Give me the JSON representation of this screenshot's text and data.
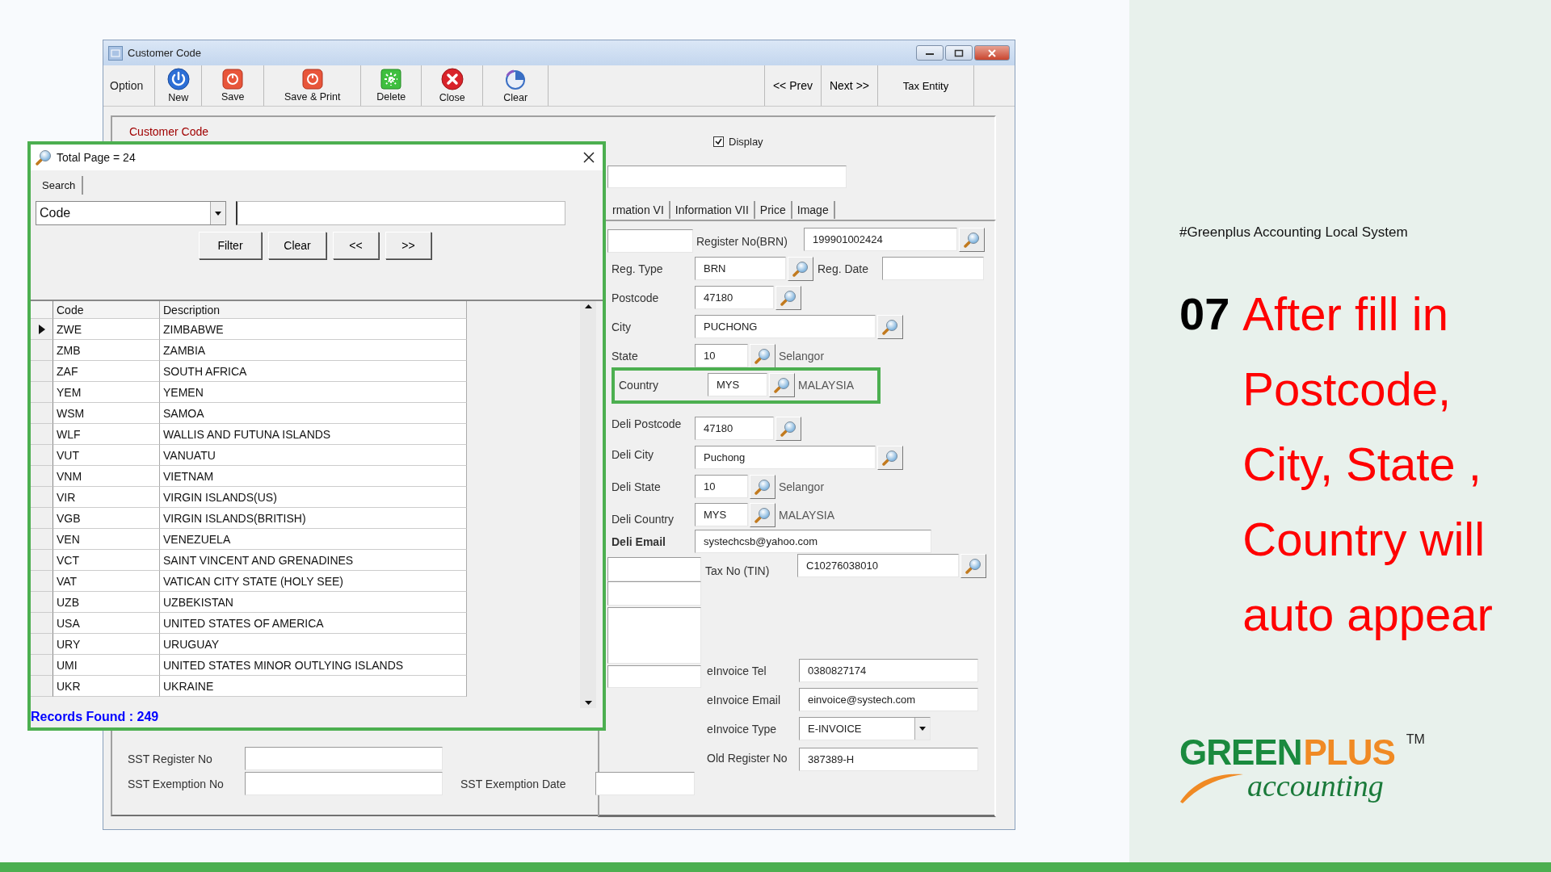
{
  "window": {
    "title": "Customer Code",
    "toolbar": {
      "option_label": "Option",
      "buttons": [
        {
          "label": "New",
          "kind": "new"
        },
        {
          "label": "Save",
          "kind": "save"
        },
        {
          "label": "Save & Print",
          "kind": "save"
        },
        {
          "label": "Delete",
          "kind": "delete"
        },
        {
          "label": "Close",
          "kind": "close"
        },
        {
          "label": "Clear",
          "kind": "clear"
        }
      ],
      "nav_buttons": [
        "<< Prev",
        "Next >>",
        "Tax Entity"
      ]
    },
    "form": {
      "customer_code_label": "Customer Code",
      "display": {
        "label": "Display",
        "checked": true
      },
      "tabs": [
        {
          "label": "rmation VI",
          "selected": false
        },
        {
          "label": "Information VII",
          "selected": false
        },
        {
          "label": "Price",
          "selected": false
        },
        {
          "label": "Image",
          "selected": false
        }
      ],
      "fields": [
        {
          "label": "Register No(BRN)",
          "value": "199901002424",
          "kind": "lookup",
          "highlighted": false
        },
        {
          "label": "Reg. Type",
          "value": "BRN",
          "kind": "lookup",
          "highlighted": false
        },
        {
          "label": "Reg. Date",
          "kind": "text",
          "highlighted": false
        },
        {
          "label": "Postcode",
          "value": "47180",
          "kind": "lookup",
          "highlighted": false
        },
        {
          "label": "City",
          "value": "PUCHONG",
          "kind": "lookup",
          "highlighted": false
        },
        {
          "label": "State",
          "value": "10",
          "kind": "lookup",
          "detail": "Selangor",
          "highlighted": false
        },
        {
          "label": "Country",
          "value": "MYS",
          "kind": "lookup",
          "detail": "MALAYSIA",
          "highlighted": true
        },
        {
          "label": "Deli Postcode",
          "value": "47180",
          "kind": "lookup",
          "highlighted": false
        },
        {
          "label": "Deli City",
          "value": "Puchong",
          "kind": "lookup",
          "highlighted": false
        },
        {
          "label": "Deli State",
          "value": "10",
          "kind": "lookup",
          "detail": "Selangor",
          "highlighted": false
        },
        {
          "label": "Deli Country",
          "value": "MYS",
          "kind": "lookup",
          "detail": "MALAYSIA",
          "highlighted": false
        },
        {
          "label": "Deli Email",
          "value": "systechcsb@yahoo.com",
          "kind": "text",
          "highlighted": false
        },
        {
          "label": "Tax No (TIN)",
          "value": "C10276038010",
          "kind": "lookup",
          "highlighted": false
        },
        {
          "label": "eInvoice Tel",
          "value": "0380827174",
          "kind": "text",
          "highlighted": false
        },
        {
          "label": "eInvoice Email",
          "value": "einvoice@systech.com",
          "kind": "text",
          "highlighted": false
        },
        {
          "label": "eInvoice Type",
          "value": "E-INVOICE",
          "kind": "combo",
          "highlighted": false
        },
        {
          "label": "SST Register No",
          "kind": "text",
          "highlighted": false
        },
        {
          "label": "Old Register No",
          "value": "387389-H",
          "kind": "text",
          "highlighted": false
        },
        {
          "label": "SST Exemption No",
          "kind": "text",
          "highlighted": false
        },
        {
          "label": "SST Exemption Date",
          "kind": "text",
          "highlighted": false
        }
      ]
    }
  },
  "lookup_dialog": {
    "title": "Total Page = 24",
    "tab": "Search",
    "search_by": "Code",
    "buttons": [
      "Filter",
      "Clear",
      "<<",
      ">>"
    ],
    "columns": [
      "Code",
      "Description"
    ],
    "rows": [
      {
        "code": "ZWE",
        "description": "ZIMBABWE",
        "selected": true
      },
      {
        "code": "ZMB",
        "description": "ZAMBIA",
        "selected": false
      },
      {
        "code": "ZAF",
        "description": "SOUTH AFRICA",
        "selected": false
      },
      {
        "code": "YEM",
        "description": "YEMEN",
        "selected": false
      },
      {
        "code": "WSM",
        "description": "SAMOA",
        "selected": false
      },
      {
        "code": "WLF",
        "description": "WALLIS AND FUTUNA ISLANDS",
        "selected": false
      },
      {
        "code": "VUT",
        "description": "VANUATU",
        "selected": false
      },
      {
        "code": "VNM",
        "description": "VIETNAM",
        "selected": false
      },
      {
        "code": "VIR",
        "description": "VIRGIN ISLANDS(US)",
        "selected": false
      },
      {
        "code": "VGB",
        "description": "VIRGIN ISLANDS(BRITISH)",
        "selected": false
      },
      {
        "code": "VEN",
        "description": "VENEZUELA",
        "selected": false
      },
      {
        "code": "VCT",
        "description": "SAINT VINCENT AND GRENADINES",
        "selected": false
      },
      {
        "code": "VAT",
        "description": "VATICAN CITY STATE (HOLY SEE)",
        "selected": false
      },
      {
        "code": "UZB",
        "description": "UZBEKISTAN",
        "selected": false
      },
      {
        "code": "USA",
        "description": "UNITED STATES OF AMERICA",
        "selected": false
      },
      {
        "code": "URY",
        "description": "URUGUAY",
        "selected": false
      },
      {
        "code": "UMI",
        "description": "UNITED STATES MINOR OUTLYING ISLANDS",
        "selected": false
      },
      {
        "code": "UKR",
        "description": "UKRAINE",
        "selected": false
      }
    ],
    "status": "Records Found : 249"
  },
  "slide": {
    "hashtag": "#Greenplus Accounting Local System",
    "step_number": "07",
    "step_text": "After fill in Postcode, City, State , Country will auto appear",
    "logo": {
      "brand_green": "GREEN",
      "brand_orange": "PLUS",
      "trademark": "TM",
      "tagline": "accounting"
    }
  }
}
